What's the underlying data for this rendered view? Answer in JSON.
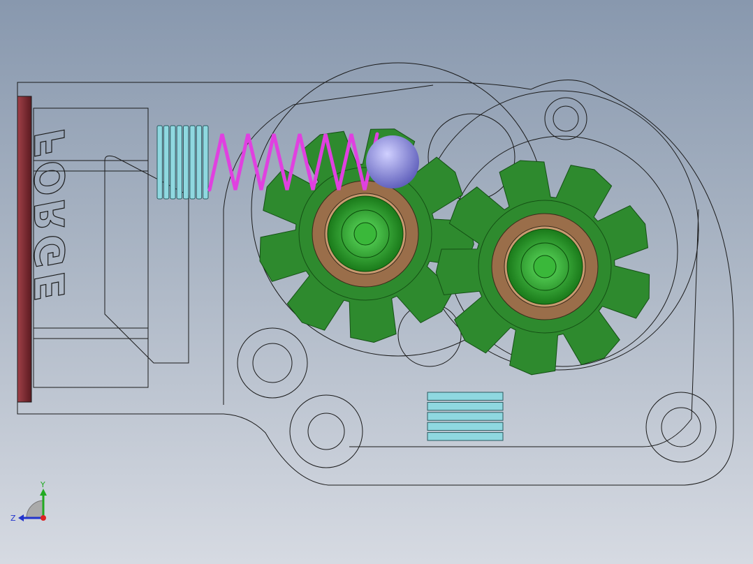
{
  "viewport": {
    "background_top": "#8898ae",
    "background_bottom": "#d6dae2"
  },
  "model": {
    "logo_text": "FORGE",
    "colors": {
      "gear": "#2e8a2e",
      "bearing": "#9a6e4a",
      "spring": "#e040e0",
      "ball": "#8888dd",
      "thread": "#8fd8e0",
      "plate": "#7a2a30",
      "outline": "#1a1a1a"
    },
    "gear_teeth": 9
  },
  "triad": {
    "y_label": "Y",
    "z_label": "Z",
    "y_color": "#22aa22",
    "z_color": "#2233cc",
    "x_color": "#dd2222"
  }
}
